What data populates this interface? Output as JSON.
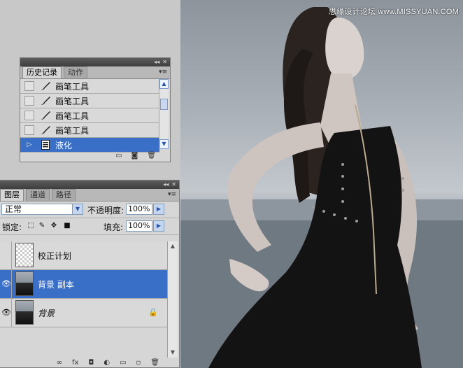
{
  "photo": {
    "watermark": "思缘设计论坛 www.MISSYUAN.COM"
  },
  "history_panel": {
    "collapse_icon": "◂◂",
    "close_icon": "✕",
    "tabs": [
      {
        "label": "历史记录",
        "active": true
      },
      {
        "label": "动作",
        "active": false
      }
    ],
    "menu_icon": "▾≡",
    "items": [
      {
        "label": "画笔工具",
        "icon": "brush-icon",
        "selected": false
      },
      {
        "label": "画笔工具",
        "icon": "brush-icon",
        "selected": false
      },
      {
        "label": "画笔工具",
        "icon": "brush-icon",
        "selected": false
      },
      {
        "label": "画笔工具",
        "icon": "brush-icon",
        "selected": false
      },
      {
        "label": "液化",
        "icon": "history-state-icon",
        "selected": true
      }
    ],
    "footer_icons": [
      "new-document-icon",
      "snapshot-icon",
      "trash-icon"
    ]
  },
  "layers_panel": {
    "tabs": [
      {
        "label": "图层",
        "active": true
      },
      {
        "label": "通道",
        "active": false
      },
      {
        "label": "路径",
        "active": false
      }
    ],
    "blend_mode": "正常",
    "opacity_label": "不透明度:",
    "opacity_value": "100%",
    "lock_label": "锁定:",
    "fill_label": "填充:",
    "fill_value": "100%",
    "layers": [
      {
        "name": "校正计划",
        "visible": false,
        "thumb": "transparent",
        "selected": false,
        "italic": false,
        "locked": false
      },
      {
        "name": "背景 副本",
        "visible": true,
        "thumb": "photo",
        "selected": true,
        "italic": false,
        "locked": false
      },
      {
        "name": "背景",
        "visible": true,
        "thumb": "photo",
        "selected": false,
        "italic": true,
        "locked": true
      }
    ],
    "footer_icons": [
      "link-icon",
      "fx-icon",
      "mask-icon",
      "adjustment-icon",
      "group-icon",
      "new-layer-icon",
      "trash-icon"
    ]
  },
  "colors": {
    "selection": "#3a6fc8",
    "panel_bg": "#d6d6d6",
    "panel_header": "#4a4a4a"
  }
}
